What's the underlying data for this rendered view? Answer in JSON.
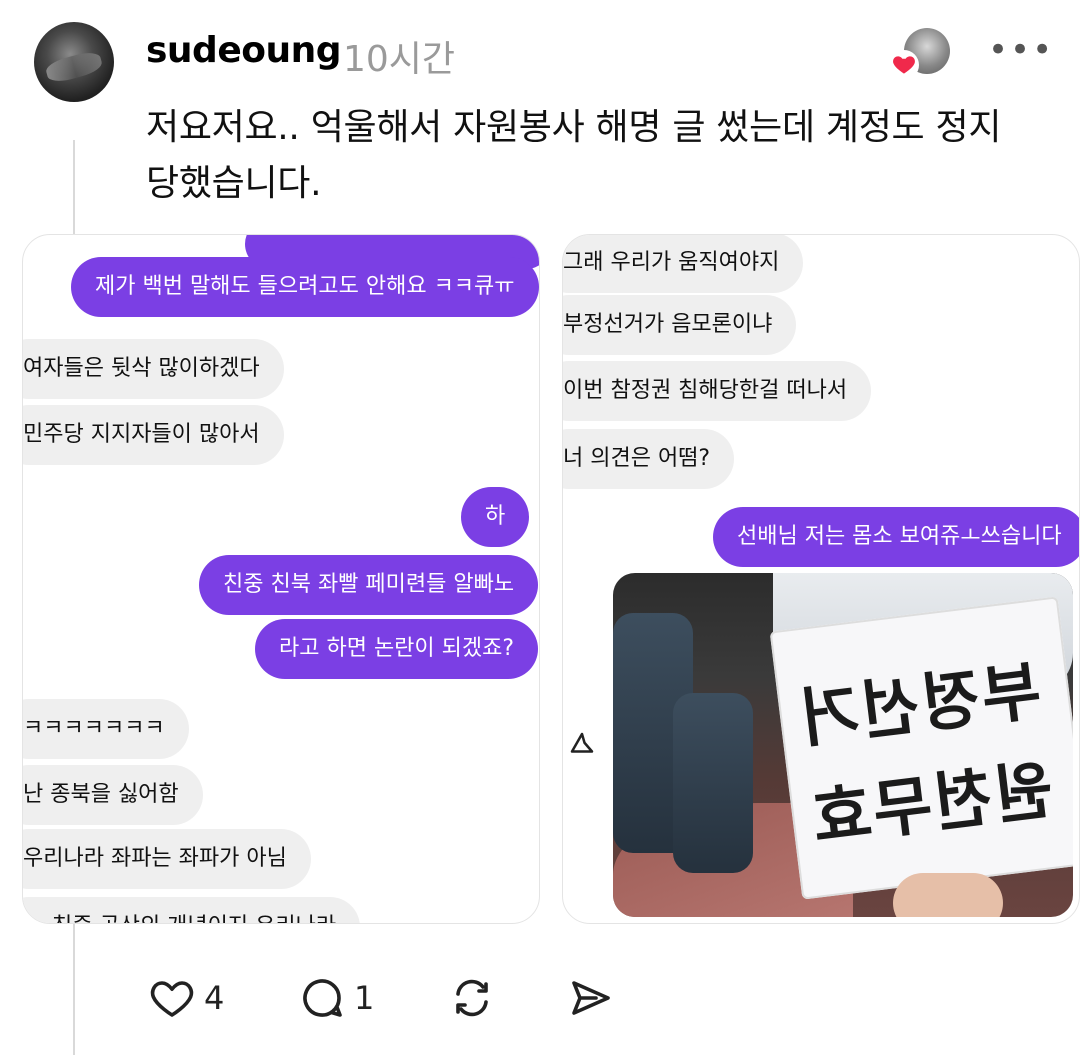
{
  "post": {
    "username": "sudeoung",
    "time": "10시간",
    "text": "저요저요.. 억울해서 자원봉사 해명 글 썼는데 계정도 정지당했습니다.",
    "more": "•••"
  },
  "screenshot_left": {
    "messages": [
      {
        "dir": "out",
        "text": ""
      },
      {
        "dir": "out",
        "text": "제가 백번 말해도 들으려고도 안해요 ㅋㅋ큐ㅠ"
      },
      {
        "dir": "in",
        "text": "여자들은 뒷삭 많이하겠다"
      },
      {
        "dir": "in",
        "text": "민주당 지지자들이 많아서"
      },
      {
        "dir": "out",
        "text": "하"
      },
      {
        "dir": "out",
        "text": "친중 친북 좌빨 페미련들 알빠노"
      },
      {
        "dir": "out",
        "text": "라고 하면 논란이 되겠죠?"
      },
      {
        "dir": "in",
        "text": "ㅋㅋㅋㅋㅋㅋㅋ"
      },
      {
        "dir": "in",
        "text": "난 종북을 싫어함"
      },
      {
        "dir": "in",
        "text": "우리나라 좌파는 좌파가 아님"
      },
      {
        "dir": "in",
        "text": "…  친중 공산의 개념이지 우리나라"
      }
    ]
  },
  "screenshot_right": {
    "messages": [
      {
        "dir": "in",
        "text": "그래 우리가 움직여야지"
      },
      {
        "dir": "in",
        "text": "부정선거가 음모론이냐"
      },
      {
        "dir": "in",
        "text": "이번 참정권 침해당한걸 떠나서"
      },
      {
        "dir": "in",
        "text": "너 의견은 어떰?"
      },
      {
        "dir": "out",
        "text": "선배님 저는 몸소 보여쥬ㅗ쓰습니다"
      }
    ],
    "photo_sign": {
      "line1": "부정선거",
      "line2": "원천무효"
    }
  },
  "actions": {
    "likes": "4",
    "comments": "1"
  },
  "colors": {
    "accent_purple": "#7b3fe4",
    "bubble_gray": "#efefef",
    "heart_red": "#f0294b"
  }
}
